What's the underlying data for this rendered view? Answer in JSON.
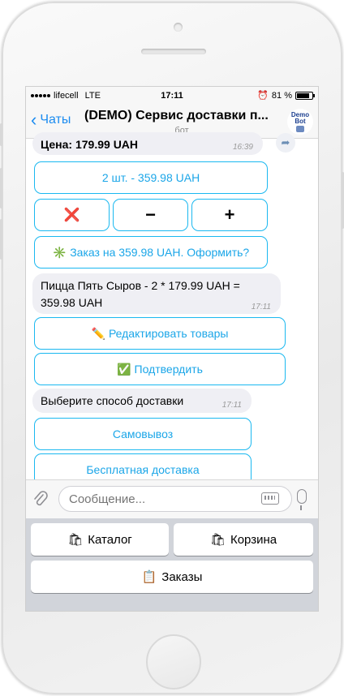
{
  "status_bar": {
    "carrier": "lifecell",
    "network": "LTE",
    "time": "17:11",
    "battery": "81 %",
    "battery_level": 0.81
  },
  "header": {
    "back_label": "Чаты",
    "title": "(DEMO) Сервис доставки п...",
    "subtitle": "бот",
    "avatar_text": "Demo Bot"
  },
  "messages": [
    {
      "text": "Цена: 179.99 UAH",
      "time": "16:39"
    },
    {
      "text": "Пицца Пять Сыров - 2 * 179.99 UAH = 359.98 UAH",
      "time": "17:11"
    },
    {
      "text": "Выберите способ доставки",
      "time": "17:11"
    }
  ],
  "inline_keyboard_1": {
    "quantity": "2 шт. - 359.98 UAH",
    "remove": "❌",
    "minus": "−",
    "plus": "+",
    "order_emoji": "✳️",
    "order": "Заказ на 359.98 UAH. Оформить?"
  },
  "inline_keyboard_2": {
    "edit_emoji": "✏️",
    "edit": "Редактировать товары",
    "confirm_emoji": "✅",
    "confirm": "Подтвердить"
  },
  "inline_keyboard_3": {
    "pickup": "Самовывоз",
    "free_delivery": "Бесплатная доставка"
  },
  "input": {
    "placeholder": "Сообщение..."
  },
  "reply_keyboard": {
    "catalog_emoji": "🛍",
    "catalog": "Каталог",
    "cart_emoji": "🛍",
    "cart": "Корзина",
    "orders_emoji": "📋",
    "orders": "Заказы"
  },
  "colors": {
    "accent": "#1c8cf0",
    "inline_button_border": "#1ab8f0",
    "bubble_bg": "#efeff4",
    "keyboard_bg": "#d1d4da"
  }
}
